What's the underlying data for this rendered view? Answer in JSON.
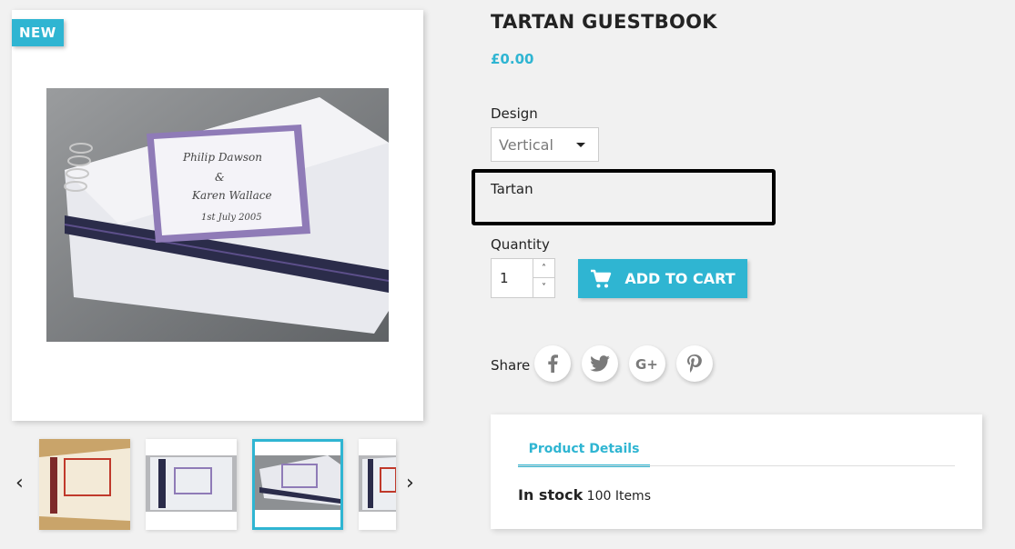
{
  "product": {
    "badge": "NEW",
    "title": "TARTAN GUESTBOOK",
    "price": "£0.00",
    "design_label": "Design",
    "design_value": "Vertical",
    "tartan_label": "Tartan",
    "quantity_label": "Quantity",
    "quantity_value": "1",
    "add_to_cart": "ADD TO CART",
    "share_label": "Share",
    "share_networks": [
      "facebook",
      "twitter",
      "google-plus",
      "pinterest"
    ]
  },
  "details": {
    "tab_label": "Product Details",
    "stock_label": "In stock",
    "stock_value": "100 Items"
  },
  "colors": {
    "accent": "#2fb5d2",
    "background": "#f1f1f1"
  },
  "thumbnails": {
    "selected_index": 2,
    "count_visible": 4
  }
}
